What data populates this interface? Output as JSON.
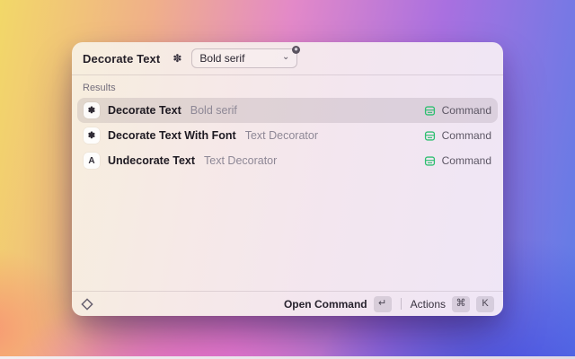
{
  "window": {
    "header": {
      "title": "Decorate Text",
      "dropdown": {
        "value": "Bold serif"
      }
    },
    "results": {
      "section_label": "Results",
      "rows": [
        {
          "title": "Decorate Text",
          "subtitle": "Bold serif",
          "accessory": "Command",
          "icon_glyph": "✽"
        },
        {
          "title": "Decorate Text With Font",
          "subtitle": "Text Decorator",
          "accessory": "Command",
          "icon_glyph": "✽"
        },
        {
          "title": "Undecorate Text",
          "subtitle": "Text Decorator",
          "accessory": "Command",
          "icon_glyph": "A"
        }
      ]
    },
    "footer": {
      "primary_action": "Open Command",
      "return_key": "↵",
      "actions_label": "Actions",
      "command_key": "⌘",
      "k_key": "K"
    }
  },
  "icons": {
    "extension_glyph": "✽",
    "chevron_down": "⌄"
  },
  "colors": {
    "accessory_green": "#2fbf71"
  }
}
